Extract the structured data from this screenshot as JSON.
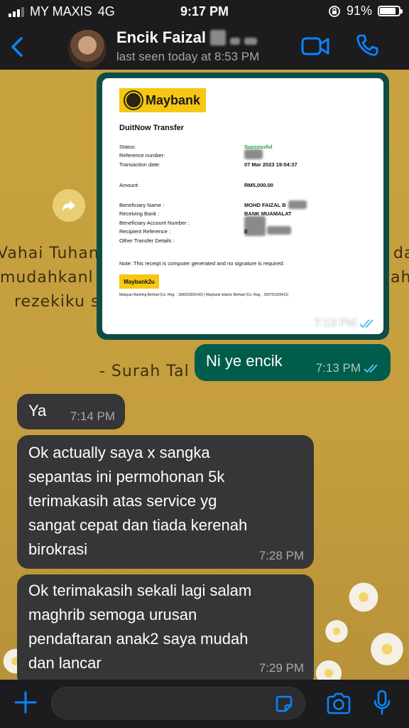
{
  "status_bar": {
    "carrier": "MY MAXIS",
    "network": "4G",
    "time": "9:17 PM",
    "battery_pct": "91%",
    "battery_level": 0.91
  },
  "header": {
    "contact_name": "Encik Faizal",
    "last_seen": "last seen today at 8:53 PM"
  },
  "wallpaper": {
    "lines": [
      "Vahai Tuhan",
      "mudahkanl",
      "rezekiku s",
      "- Surah Tal",
      "da",
      "ah"
    ]
  },
  "receipt": {
    "bank_logo": "Maybank",
    "title": "DuitNow Transfer",
    "rows": [
      {
        "label": "Status:",
        "value": "Successful"
      },
      {
        "label": "Reference number:",
        "value": ""
      },
      {
        "label": "Transaction date:",
        "value": "07 Mar 2023 19:04:37"
      },
      {
        "label": "Amount:",
        "value": "RM5,000.00"
      },
      {
        "label": "Beneficiary Name :",
        "value": "MOHD FAIZAL B"
      },
      {
        "label": "Receiving Bank :",
        "value": "BANK MUAMALAT"
      },
      {
        "label": "Beneficiary Account Number :",
        "value": ""
      },
      {
        "label": "Recipient Reference :",
        "value": "E"
      },
      {
        "label": "Other Transfer Details :",
        "value": ""
      }
    ],
    "note": "Note: This receipt is computer generated and no signature is required.",
    "m2u_logo": "Maybank2u",
    "footer": "Malayan Banking Berhad (Co. Reg. : 196001000142)  |  Maybank Islamic Berhad (Co. Reg. : 200701029411)"
  },
  "messages": [
    {
      "type": "image",
      "direction": "outgoing",
      "time": "7:13 PM",
      "status": "read"
    },
    {
      "type": "text",
      "direction": "outgoing",
      "text": "Ni ye encik",
      "time": "7:13 PM",
      "status": "read"
    },
    {
      "type": "text",
      "direction": "incoming",
      "text": "Ya",
      "time": "7:14 PM"
    },
    {
      "type": "text",
      "direction": "incoming",
      "text": "Ok actually saya x sangka\nsepantas ini permohonan 5k\nterimakasih atas service yg\nsangat cepat dan tiada kerenah\nbirokrasi",
      "time": "7:28 PM"
    },
    {
      "type": "text",
      "direction": "incoming",
      "text": "Ok terimakasih sekali lagi salam\nmaghrib semoga urusan\npendaftaran anak2 saya mudah\ndan lancar",
      "time": "7:29 PM"
    }
  ],
  "composer": {
    "placeholder": "",
    "value": ""
  },
  "colors": {
    "accent": "#0a84ff",
    "outgoing_bubble": "#005c4b",
    "incoming_bubble": "#363638",
    "read_ticks": "#53bdeb",
    "bar_bg": "#1c1c1e",
    "success": "#1a9e3a"
  },
  "icons": [
    "back-chevron-icon",
    "video-call-icon",
    "phone-call-icon",
    "forward-icon",
    "read-receipt-icon",
    "plus-icon",
    "sticker-icon",
    "camera-icon",
    "microphone-icon"
  ]
}
